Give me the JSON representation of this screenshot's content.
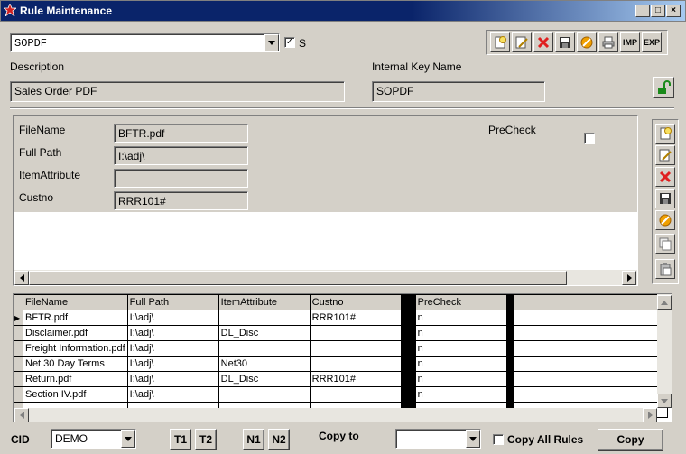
{
  "window": {
    "title": "Rule Maintenance",
    "minimize_label": "_",
    "maximize_label": "□",
    "close_label": "×"
  },
  "top": {
    "rule_select_value": "SOPDF",
    "s_checkbox_checked": true,
    "s_checkbox_mark": "✓",
    "s_label": "S",
    "toolbar": {
      "imp_label": "IMP",
      "exp_label": "EXP"
    }
  },
  "header": {
    "description_label": "Description",
    "description_value": "Sales Order PDF",
    "internal_key_label": "Internal Key Name",
    "internal_key_value": "SOPDF"
  },
  "detail": {
    "filename_label": "FileName",
    "filename_value": "BFTR.pdf",
    "fullpath_label": "Full Path",
    "fullpath_value": "I:\\adj\\",
    "itemattribute_label": "ItemAttribute",
    "itemattribute_value": "",
    "custno_label": "Custno",
    "custno_value": "RRR101#",
    "precheck_label": "PreCheck",
    "precheck_checked": false
  },
  "grid": {
    "columns": [
      "FileName",
      "Full Path",
      "ItemAttribute",
      "Custno",
      "",
      "PreCheck",
      ""
    ],
    "rows": [
      {
        "filename": "BFTR.pdf",
        "fullpath": "I:\\adj\\",
        "itemattribute": "",
        "custno": "RRR101#",
        "precheck": "n",
        "current": true
      },
      {
        "filename": "Disclaimer.pdf",
        "fullpath": "I:\\adj\\",
        "itemattribute": "DL_Disc",
        "custno": "",
        "precheck": "n",
        "current": false
      },
      {
        "filename": "Freight Information.pdf",
        "fullpath": "I:\\adj\\",
        "itemattribute": "",
        "custno": "",
        "precheck": "n",
        "current": false
      },
      {
        "filename": "Net 30 Day Terms",
        "fullpath": "I:\\adj\\",
        "itemattribute": "Net30",
        "custno": "",
        "precheck": "n",
        "current": false
      },
      {
        "filename": "Return.pdf",
        "fullpath": "I:\\adj\\",
        "itemattribute": "DL_Disc",
        "custno": "RRR101#",
        "precheck": "n",
        "current": false
      },
      {
        "filename": "Section IV.pdf",
        "fullpath": "I:\\adj\\",
        "itemattribute": "",
        "custno": "",
        "precheck": "n",
        "current": false
      }
    ]
  },
  "bottom": {
    "cid_label": "CID",
    "cid_value": "DEMO",
    "t1_label": "T1",
    "t2_label": "T2",
    "n1_label": "N1",
    "n2_label": "N2",
    "copy_to_label": "Copy to",
    "copy_to_value": "",
    "copy_all_rules_label": "Copy All Rules",
    "copy_all_rules_checked": false,
    "copy_button_label": "Copy"
  },
  "colors": {
    "titlebar": "#0a246a",
    "window_bg": "#d4d0c8",
    "lock_green": "#1a8a1a",
    "delete_red": "#e02020",
    "cancel_orange": "#f0a000",
    "new_yellow": "#f8e060"
  }
}
